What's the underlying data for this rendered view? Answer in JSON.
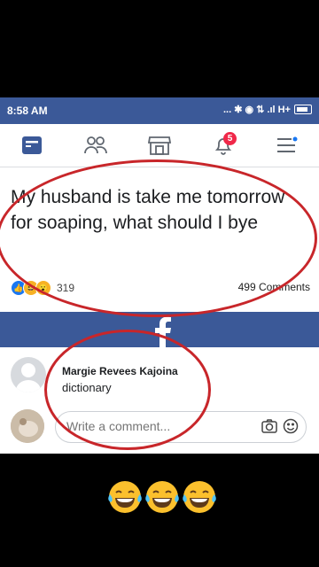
{
  "status": {
    "time": "8:58 AM",
    "icons_text": "... ✱ ◉ ⇅ .ıl H+"
  },
  "navbar": {
    "items": [
      "news-feed-icon",
      "friends-icon",
      "marketplace-icon",
      "notifications-icon",
      "menu-icon"
    ],
    "notification_badge": "5"
  },
  "post": {
    "text": "My husband is take me tomorrow for soaping, what should I bye",
    "reaction_count": "319",
    "comments_count": "499 Comments"
  },
  "comment": {
    "author": "Margie Revees Kajoina",
    "text": "dictionary"
  },
  "composer": {
    "placeholder": "Write a comment..."
  },
  "colors": {
    "facebook_blue": "#3b5998",
    "highlight_red": "#c8262a"
  },
  "caption_emoji": [
    "tears-of-joy",
    "tears-of-joy",
    "tears-of-joy"
  ]
}
